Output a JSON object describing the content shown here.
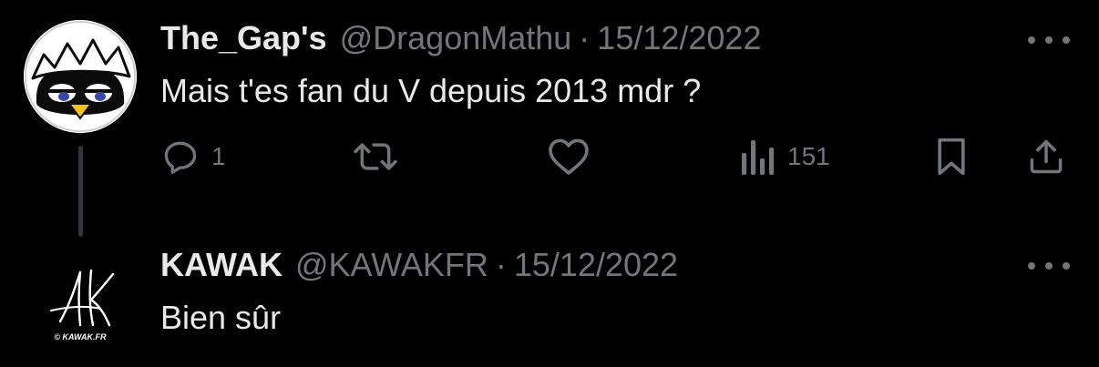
{
  "tweets": [
    {
      "display_name": "The_Gap's",
      "handle": "@DragonMathu",
      "separator": "·",
      "date": "15/12/2022",
      "text": "Mais t'es fan du V depuis 2013 mdr ?",
      "avatar_icon": "cartoon-chick-avatar",
      "actions": {
        "reply_count": "1",
        "retweet_count": "",
        "like_count": "",
        "views_count": "151"
      }
    },
    {
      "display_name": "KAWAK",
      "handle": "@KAWAKFR",
      "separator": "·",
      "date": "15/12/2022",
      "text": "Bien sûr",
      "avatar_icon": "kawak-logo-avatar",
      "avatar_caption": "© KAWAK.FR"
    }
  ],
  "colors": {
    "background": "#000000",
    "primary_text": "#e7e9ea",
    "secondary_text": "#71767b",
    "thread_line": "#333639"
  }
}
